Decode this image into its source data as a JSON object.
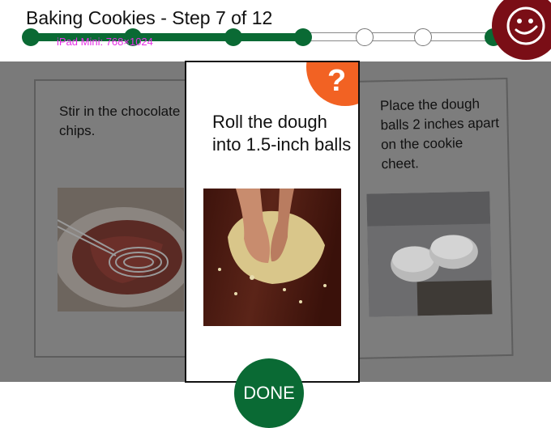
{
  "header": {
    "title": "Baking Cookies - Step 7 of 12",
    "device_label": "iPad Mini: 768×1024"
  },
  "progress": {
    "current_step": 7,
    "total_steps": 12
  },
  "cards": {
    "previous": {
      "text": "Stir in the chocolate chips.",
      "image_icon": "whisk-bowl-photo"
    },
    "current": {
      "text": "Roll the dough into 1.5-inch balls",
      "image_icon": "hands-dough-photo"
    },
    "next": {
      "text": "Place the dough balls 2 inches apart on the cookie cheet.",
      "image_icon": "dough-balls-photo"
    }
  },
  "help": {
    "label": "?"
  },
  "done": {
    "label": "DONE"
  },
  "colors": {
    "progress_green": "#0a6a34",
    "help_orange": "#f26223",
    "avatar_maroon": "#7a0e16",
    "overlay_gray": "#7a7a7a"
  },
  "icons": {
    "avatar": "smiley-face-icon",
    "help": "question-mark-icon"
  }
}
